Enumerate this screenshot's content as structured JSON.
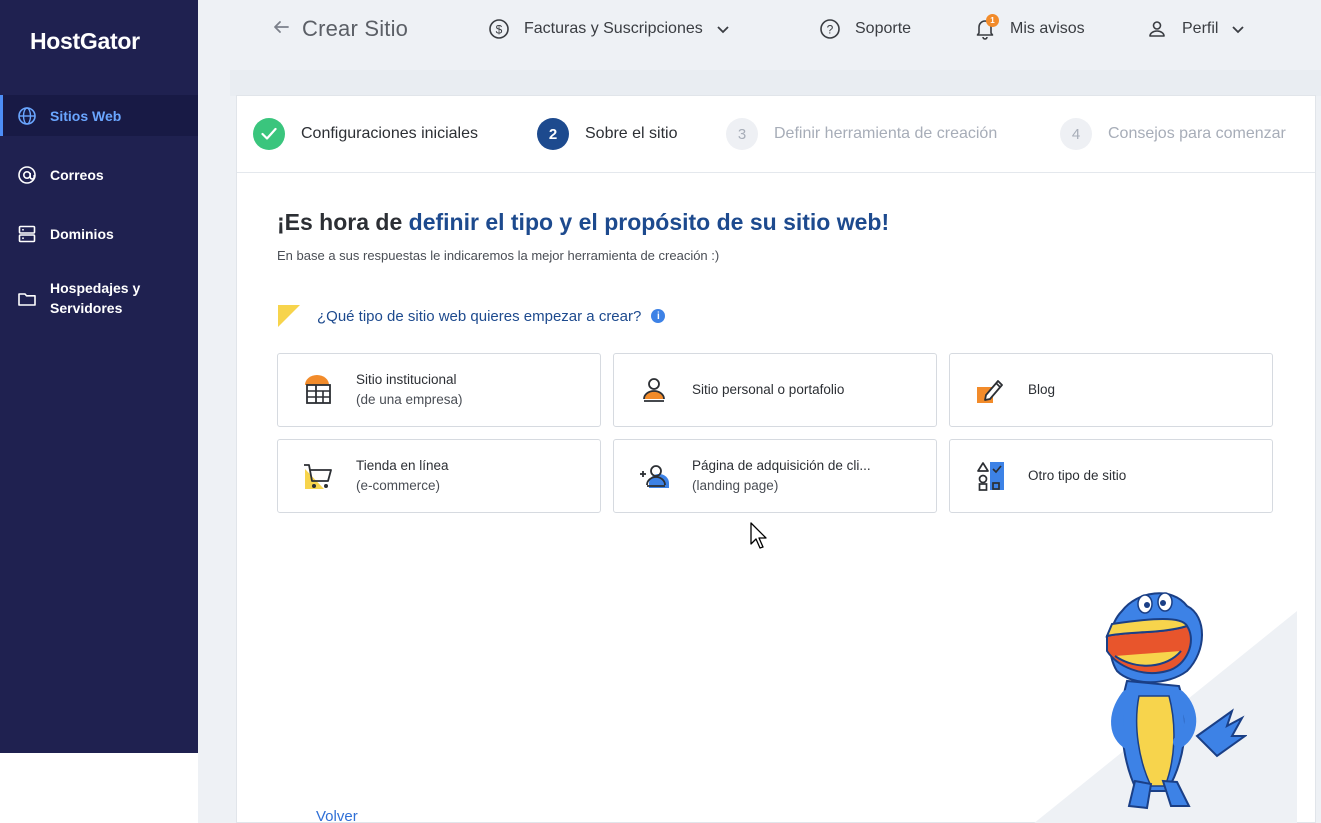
{
  "brand": "HostGator",
  "sidebar": {
    "items": [
      {
        "label": "Sitios Web",
        "icon": "globe-icon",
        "active": true
      },
      {
        "label": "Correos",
        "icon": "at-icon",
        "active": false
      },
      {
        "label": "Dominios",
        "icon": "server-icon",
        "active": false
      },
      {
        "label": "Hospedajes y Servidores",
        "icon": "folder-icon",
        "active": false
      }
    ]
  },
  "topbar": {
    "back_icon": "arrow-left-icon",
    "page_title": "Crear Sitio",
    "billing": "Facturas y Suscripciones",
    "support": "Soporte",
    "notices": "Mis avisos",
    "notices_count": "1",
    "profile": "Perfil"
  },
  "stepper": {
    "steps": [
      {
        "number": "",
        "label": "Configuraciones iniciales",
        "state": "done"
      },
      {
        "number": "2",
        "label": "Sobre el sitio",
        "state": "current"
      },
      {
        "number": "3",
        "label": "Definir herramienta de creación",
        "state": "todo"
      },
      {
        "number": "4",
        "label": "Consejos para comenzar",
        "state": "todo"
      }
    ]
  },
  "main": {
    "heading_prefix": "¡Es hora de ",
    "heading_highlight": "definir el tipo y el propósito de su sitio web!",
    "subheading": "En base a sus respuestas le indicaremos la mejor herramienta de creación :)",
    "question": "¿Qué tipo de sitio web quieres empezar a crear?",
    "options": [
      {
        "line1": "Sitio institucional",
        "line2": "(de una empresa)",
        "icon": "building-icon"
      },
      {
        "line1": "Sitio personal o portafolio",
        "line2": "",
        "icon": "person-icon"
      },
      {
        "line1": "Blog",
        "line2": "",
        "icon": "pencil-icon"
      },
      {
        "line1": "Tienda en línea",
        "line2": "(e-commerce)",
        "icon": "cart-icon"
      },
      {
        "line1": "Página de adquisición de cli...",
        "line2": "(landing page)",
        "icon": "add-person-icon"
      },
      {
        "line1": "Otro tipo de sitio",
        "line2": "",
        "icon": "shapes-icon"
      }
    ],
    "back_link": "Volver"
  },
  "colors": {
    "sidebar_bg": "#1f2150",
    "accent_blue": "#1d4a8e",
    "success_green": "#3ac57d",
    "orange": "#f28b2a",
    "yellow": "#f7d44c"
  }
}
